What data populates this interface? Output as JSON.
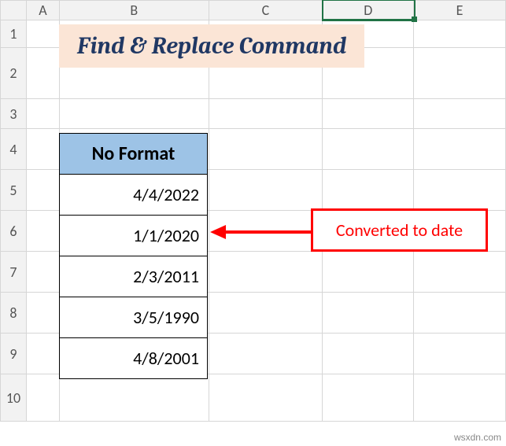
{
  "columns": [
    "A",
    "B",
    "C",
    "D",
    "E"
  ],
  "rows": [
    "1",
    "2",
    "3",
    "4",
    "5",
    "6",
    "7",
    "8",
    "9",
    "10"
  ],
  "selected_col": "D",
  "title": "Find & Replace Command",
  "table": {
    "header": "No Format",
    "values": [
      "4/4/2022",
      "1/1/2020",
      "2/3/2011",
      "3/5/1990",
      "4/8/2001"
    ]
  },
  "annotation": "Converted to date",
  "watermark": "wsxdn.com"
}
